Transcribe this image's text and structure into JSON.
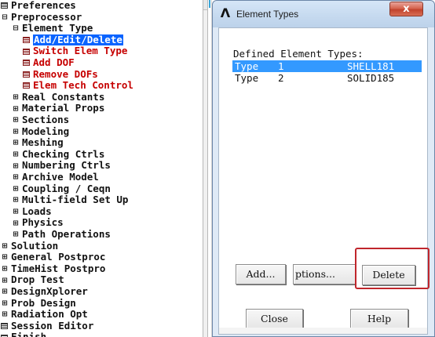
{
  "tree": {
    "items": [
      {
        "label": "Preferences",
        "prefix": "box",
        "indent": 0,
        "color": "black"
      },
      {
        "label": "Preprocessor",
        "prefix": "minus",
        "indent": 0,
        "color": "black"
      },
      {
        "label": "Element Type",
        "prefix": "minus",
        "indent": 1,
        "color": "black"
      },
      {
        "label": "Add/Edit/Delete",
        "prefix": "box-red",
        "indent": 2,
        "color": "selected"
      },
      {
        "label": "Switch Elem Type",
        "prefix": "box-red",
        "indent": 2,
        "color": "red"
      },
      {
        "label": "Add DOF",
        "prefix": "box-red",
        "indent": 2,
        "color": "red"
      },
      {
        "label": "Remove DOFs",
        "prefix": "box-red",
        "indent": 2,
        "color": "red"
      },
      {
        "label": "Elem Tech Control",
        "prefix": "box-red",
        "indent": 2,
        "color": "red"
      },
      {
        "label": "Real Constants",
        "prefix": "plus",
        "indent": 1,
        "color": "black"
      },
      {
        "label": "Material Props",
        "prefix": "plus",
        "indent": 1,
        "color": "black"
      },
      {
        "label": "Sections",
        "prefix": "plus",
        "indent": 1,
        "color": "black"
      },
      {
        "label": "Modeling",
        "prefix": "plus",
        "indent": 1,
        "color": "black"
      },
      {
        "label": "Meshing",
        "prefix": "plus",
        "indent": 1,
        "color": "black"
      },
      {
        "label": "Checking Ctrls",
        "prefix": "plus",
        "indent": 1,
        "color": "black"
      },
      {
        "label": "Numbering Ctrls",
        "prefix": "plus",
        "indent": 1,
        "color": "black"
      },
      {
        "label": "Archive Model",
        "prefix": "plus",
        "indent": 1,
        "color": "black"
      },
      {
        "label": "Coupling / Ceqn",
        "prefix": "plus",
        "indent": 1,
        "color": "black"
      },
      {
        "label": "Multi-field Set Up",
        "prefix": "plus",
        "indent": 1,
        "color": "black"
      },
      {
        "label": "Loads",
        "prefix": "plus",
        "indent": 1,
        "color": "black"
      },
      {
        "label": "Physics",
        "prefix": "plus",
        "indent": 1,
        "color": "black"
      },
      {
        "label": "Path Operations",
        "prefix": "plus",
        "indent": 1,
        "color": "black"
      },
      {
        "label": "Solution",
        "prefix": "plus",
        "indent": 0,
        "color": "black"
      },
      {
        "label": "General Postproc",
        "prefix": "plus",
        "indent": 0,
        "color": "black"
      },
      {
        "label": "TimeHist Postpro",
        "prefix": "plus",
        "indent": 0,
        "color": "black"
      },
      {
        "label": "Drop Test",
        "prefix": "plus",
        "indent": 0,
        "color": "black"
      },
      {
        "label": "DesignXplorer",
        "prefix": "plus",
        "indent": 0,
        "color": "black"
      },
      {
        "label": "Prob Design",
        "prefix": "plus",
        "indent": 0,
        "color": "black"
      },
      {
        "label": "Radiation Opt",
        "prefix": "plus",
        "indent": 0,
        "color": "black"
      },
      {
        "label": "Session Editor",
        "prefix": "box",
        "indent": 0,
        "color": "black"
      },
      {
        "label": "Finish",
        "prefix": "box",
        "indent": 0,
        "color": "black"
      }
    ]
  },
  "dialog": {
    "title": "Element Types",
    "close_glyph": "x",
    "app_icon_glyph": "Λ",
    "defined_label": "Defined Element Types:",
    "element_types": [
      {
        "word": "Type",
        "number": "1",
        "name": "SHELL181",
        "selected": true
      },
      {
        "word": "Type",
        "number": "2",
        "name": "SOLID185",
        "selected": false
      }
    ],
    "buttons": {
      "add": "Add...",
      "options": "ptions...",
      "delete": "Delete",
      "close": "Close",
      "help": "Help"
    }
  },
  "colors": {
    "tree_selected_bg": "#0a64ff",
    "tree_red": "#c60000",
    "list_selected_bg": "#3399ff",
    "highlight_border": "#c0262c"
  },
  "icons": {
    "tree_leaf": "box-menu-icon",
    "tree_expand": "plus-icon",
    "tree_collapse": "minus-icon",
    "dialog_app": "ansys-logo-icon",
    "dialog_close": "close-icon"
  }
}
